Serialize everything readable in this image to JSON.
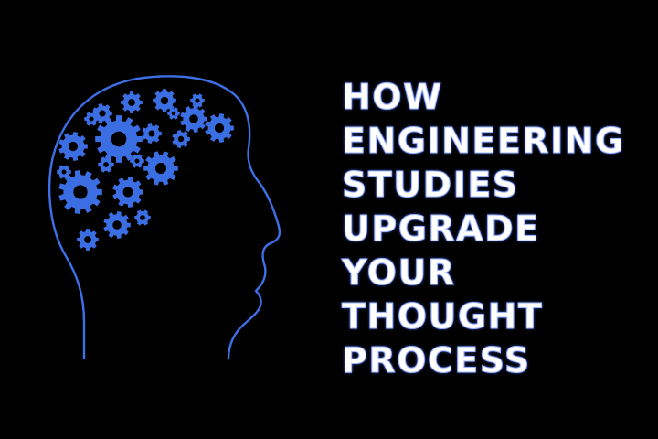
{
  "colors": {
    "background": "#000000",
    "gear_blue": "#3b6ee3",
    "outline_blue": "#3d6fe6",
    "headline_text": "#ffffff",
    "headline_glow": "#4b6fff"
  },
  "illustration": {
    "icon": "head-with-gears-icon"
  },
  "headline": {
    "lines": [
      "HOW",
      "ENGINEERING",
      "STUDIES",
      "UPGRADE",
      "YOUR",
      "THOUGHT",
      "PROCESS"
    ]
  }
}
